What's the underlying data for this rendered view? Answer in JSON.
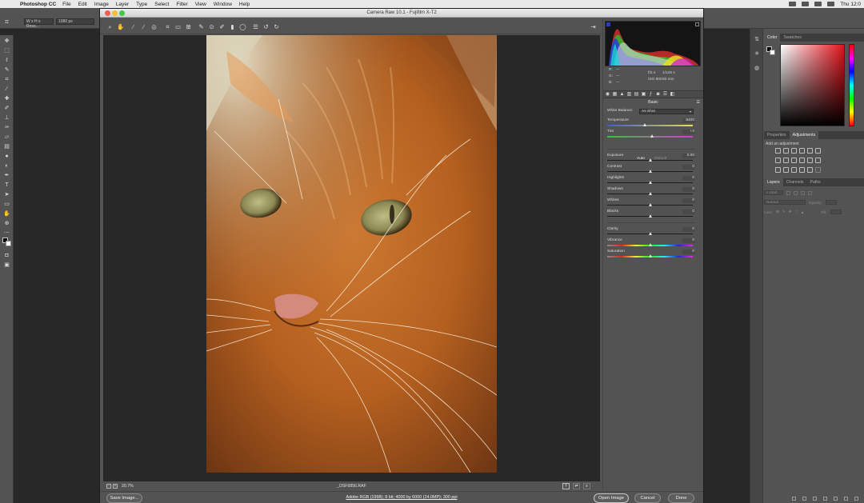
{
  "menubar": {
    "app_name": "Photoshop CC",
    "items": [
      "File",
      "Edit",
      "Image",
      "Layer",
      "Type",
      "Select",
      "Filter",
      "View",
      "Window",
      "Help"
    ],
    "clock": "Thu 12:0"
  },
  "optionbar": {
    "width_height_label": "W x H x Reso...",
    "pixels_value": "1080 px"
  },
  "photoshop_panels": {
    "color_tabs": [
      "Color",
      "Swatches"
    ],
    "prop_tabs": [
      "Properties",
      "Adjustments"
    ],
    "add_adjustment_label": "Add an adjustment",
    "layer_tabs": [
      "Layers",
      "Channels",
      "Paths"
    ],
    "kind_label": "Kind",
    "blend_mode": "Normal",
    "opacity_label": "Opacity:",
    "lock_label": "Lock:",
    "fill_label": "Fill:"
  },
  "camera_raw": {
    "window_title": "Camera Raw 10.1  -  Fujifilm X-T2",
    "readout": {
      "r": "R:",
      "g": "G:",
      "b": "B:",
      "dash": "---",
      "aperture": "f/2.4",
      "shutter": "1/125 s",
      "iso": "ISO 800",
      "focal": "60 mm"
    },
    "panel_title": "Basic",
    "white_balance_label": "White Balance:",
    "white_balance_value": "As Shot",
    "auto_label": "Auto",
    "default_label": "Default",
    "sliders": [
      {
        "label": "Temperature",
        "value": "6400",
        "pos": 0.44
      },
      {
        "label": "Tint",
        "value": "+4",
        "pos": 0.52
      },
      {
        "label": "Exposure",
        "value": "0.00",
        "pos": 0.5
      },
      {
        "label": "Contrast",
        "value": "0",
        "pos": 0.5
      },
      {
        "label": "Highlights",
        "value": "0",
        "pos": 0.5
      },
      {
        "label": "Shadows",
        "value": "0",
        "pos": 0.5
      },
      {
        "label": "Whites",
        "value": "0",
        "pos": 0.5
      },
      {
        "label": "Blacks",
        "value": "0",
        "pos": 0.5
      },
      {
        "label": "Clarity",
        "value": "0",
        "pos": 0.5
      },
      {
        "label": "Vibrance",
        "value": "0",
        "pos": 0.5
      },
      {
        "label": "Saturation",
        "value": "0",
        "pos": 0.5
      }
    ],
    "zoom": "20.7%",
    "filename": "_DSF6856.RAF",
    "save_button": "Save Image...",
    "workflow_link": "Adobe RGB (1998); 8 bit; 4000 by 6000 (24.0MP); 300 ppi",
    "open_button": "Open Image",
    "cancel_button": "Cancel",
    "done_button": "Done",
    "view_button": "Y"
  },
  "colors": {
    "traffic_red": "#ec5f58",
    "traffic_yellow": "#f3bf33",
    "traffic_green": "#3dc94a"
  }
}
